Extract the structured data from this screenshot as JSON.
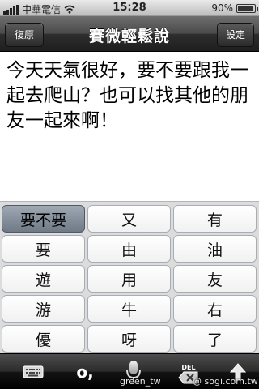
{
  "status_bar": {
    "carrier": "中華電信",
    "time": "15:28",
    "battery_text": "90%",
    "battery_level": 0.9
  },
  "nav": {
    "title": "賽微輕鬆說",
    "left_button": "復原",
    "right_button": "設定"
  },
  "text_content": "今天天氣很好，要不要跟我一起去爬山？也可以找其他的朋友一起來啊！",
  "candidates": [
    [
      "要不要",
      "又",
      "有"
    ],
    [
      "要",
      "由",
      "油"
    ],
    [
      "遊",
      "用",
      "友"
    ],
    [
      "游",
      "牛",
      "右"
    ],
    [
      "優",
      "呀",
      "了"
    ]
  ],
  "selected_candidate": "要不要",
  "toolbar": {
    "keyboard_icon": "keyboard-icon",
    "punctuation_label": "o,",
    "mic_icon": "microphone-icon",
    "delete_label": "DEL",
    "send_icon": "send-arrow-icon"
  },
  "watermark": {
    "left": "green_tw",
    "right": "@ sogi.com.tw"
  }
}
